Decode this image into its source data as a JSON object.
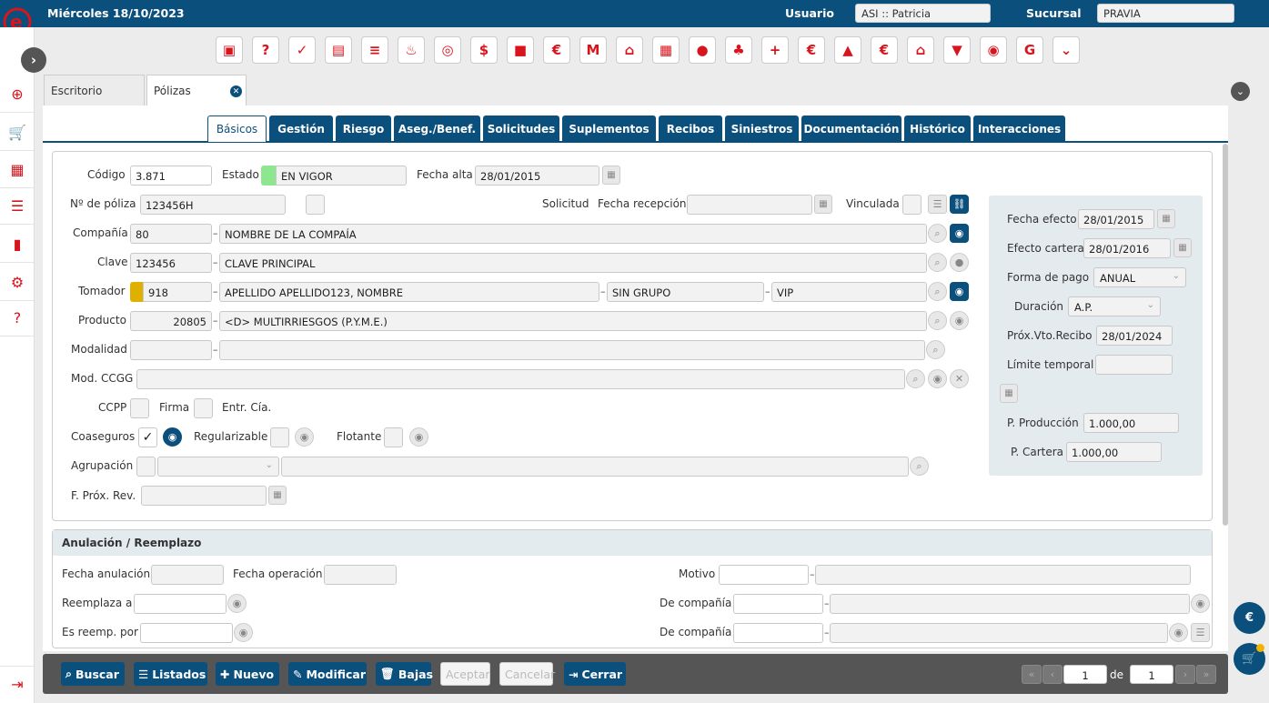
{
  "header": {
    "date": "Miércoles 18/10/2023",
    "user_label": "Usuario",
    "user_value": "ASI :: Patricia",
    "branch_label": "Sucursal",
    "branch_value": "PRAVIA"
  },
  "left_rail": {
    "icons": [
      "plus-circle-icon",
      "cart-icon",
      "building-icon",
      "settings-sliders-icon",
      "bar-chart-icon",
      "gear-icon",
      "help-icon",
      "logout-icon"
    ]
  },
  "toolbar_icons": [
    "cube",
    "user-question",
    "user-check",
    "document",
    "list",
    "fire",
    "target",
    "money",
    "briefcase",
    "bag-euro",
    "chart-m",
    "building",
    "buildings",
    "person",
    "people",
    "building-plus",
    "euro-arrows",
    "people-up",
    "euro-circle",
    "house-euro",
    "shield-euro",
    "eye-share",
    "letter-g",
    "chevron-down"
  ],
  "window_tabs": [
    "Escritorio",
    "Pólizas"
  ],
  "section_tabs": [
    "Básicos",
    "Gestión",
    "Riesgo",
    "Aseg./Benef.",
    "Solicitudes",
    "Suplementos",
    "Recibos",
    "Siniestros",
    "Documentación",
    "Histórico",
    "Interacciones"
  ],
  "form": {
    "codigo_label": "Código",
    "codigo": "3.871",
    "estado_label": "Estado",
    "estado": "EN VIGOR",
    "fecha_alta_label": "Fecha alta",
    "fecha_alta": "28/01/2015",
    "poliza_label": "Nº de póliza",
    "poliza": "123456H",
    "solicitud_label": "Solicitud",
    "fecha_recepcion_label": "Fecha recepción",
    "vinculada_label": "Vinculada",
    "compania_label": "Compañía",
    "compania_code": "80",
    "compania_name": "NOMBRE DE LA COMPAÍA",
    "clave_label": "Clave",
    "clave_code": "123456",
    "clave_name": "CLAVE PRINCIPAL",
    "tomador_label": "Tomador",
    "tomador_code": "918",
    "tomador_name": "APELLIDO APELLIDO123, NOMBRE",
    "tomador_grupo": "SIN GRUPO",
    "tomador_tipo": "VIP",
    "producto_label": "Producto",
    "producto_code": "20805",
    "producto_name": "<D> MULTIRRIESGOS (P.Y.M.E.)",
    "modalidad_label": "Modalidad",
    "modccgg_label": "Mod. CCGG",
    "ccpp_label": "CCPP",
    "firma_label": "Firma",
    "entr_label": "Entr. Cía.",
    "coaseguros_label": "Coaseguros",
    "regularizable_label": "Regularizable",
    "flotante_label": "Flotante",
    "agrupacion_label": "Agrupación",
    "fprox_label": "F. Próx. Rev."
  },
  "side_panel": {
    "fecha_efecto_label": "Fecha efecto",
    "fecha_efecto": "28/01/2015",
    "efecto_cartera_label": "Efecto cartera",
    "efecto_cartera": "28/01/2016",
    "forma_pago_label": "Forma de pago",
    "forma_pago": "ANUAL",
    "duracion_label": "Duración",
    "duracion": "A.P.",
    "prox_vto_label": "Próx.Vto.Recibo",
    "prox_vto": "28/01/2024",
    "limite_label": "Límite temporal",
    "p_produccion_label": "P. Producción",
    "p_produccion": "1.000,00",
    "p_cartera_label": "P. Cartera",
    "p_cartera": "1.000,00"
  },
  "anulacion": {
    "title": "Anulación / Reemplazo",
    "fecha_anulacion_label": "Fecha anulación",
    "fecha_operacion_label": "Fecha operación",
    "motivo_label": "Motivo",
    "reemplaza_label": "Reemplaza a",
    "de_compania_label": "De compañía",
    "es_reemp_label": "Es reemp. por"
  },
  "bottom_bar": {
    "buttons": [
      "Buscar",
      "Listados",
      "Nuevo",
      "Modificar",
      "Bajas",
      "Aceptar",
      "Cancelar",
      "Cerrar"
    ],
    "page": "1",
    "of_label": "de",
    "total": "1"
  },
  "colors": {
    "brand_blue": "#0b4f7c",
    "brand_red": "#d8141c",
    "estado_green": "#8ee68e",
    "tomador_gold": "#e0b000"
  }
}
